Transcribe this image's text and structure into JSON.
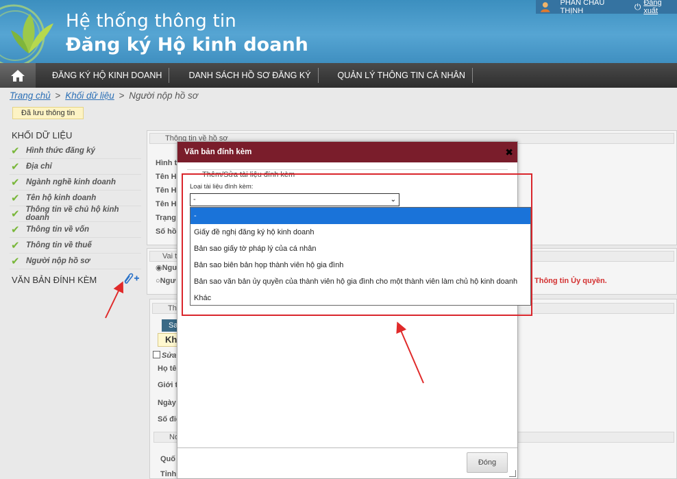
{
  "header": {
    "title_line1": "Hệ thống thông tin",
    "title_line2": "Đăng ký Hộ kinh doanh",
    "user_name": "PHAN CHÂU THỊNH",
    "logout_label": "Đăng xuất"
  },
  "nav": {
    "items": [
      {
        "label": "ĐĂNG KÝ HỘ KINH DOANH"
      },
      {
        "label": "DANH SÁCH HỒ SƠ ĐĂNG KÝ"
      },
      {
        "label": "QUẢN LÝ THÔNG TIN CÁ NHÂN"
      }
    ]
  },
  "breadcrumb": {
    "home": "Trang chủ",
    "section": "Khối dữ liệu",
    "current": "Người nộp hồ sơ",
    "sep": ">"
  },
  "saved_badge": "Đã lưu thông tin",
  "sidebar": {
    "title": "KHỐI DỮ LIỆU",
    "items": [
      {
        "label": "Hình thức đăng ký"
      },
      {
        "label": "Địa chỉ"
      },
      {
        "label": "Ngành nghề kinh doanh"
      },
      {
        "label": "Tên hộ kinh doanh"
      },
      {
        "label": "Thông tin về chủ hộ kinh doanh"
      },
      {
        "label": "Thông tin về vốn"
      },
      {
        "label": "Thông tin về thuế"
      },
      {
        "label": "Người nộp hồ sơ"
      }
    ],
    "attach_title": "VĂN BẢN ĐÍNH KÈM"
  },
  "background": {
    "legend1": "Thông tin về hồ sơ",
    "labels": [
      "Hình t",
      "Tên H",
      "Tên H",
      "Tên H",
      "Trạng",
      "Số hồ"
    ],
    "legend2": "Vai t",
    "radio1": "Ngư",
    "radio2": "Ngư",
    "legend3": "Thô",
    "btn_small": "Sa",
    "kh": "Kh",
    "sua": "Sửa",
    "labels2": [
      "Họ tê",
      "Giới t",
      "Ngày",
      "Số điệ"
    ],
    "legend4": "No",
    "labels3": [
      "Quố",
      "Tỉnh"
    ],
    "red_note": "Thông tin Ủy quyền."
  },
  "modal": {
    "title": "Văn bản đính kèm",
    "fieldset_label": "Thêm/Sửa tài liệu đính kèm",
    "field_label": "Loại tài liệu đính kèm:",
    "select_value": "-",
    "close_button": "Đóng",
    "options": [
      {
        "label": "-",
        "selected": true
      },
      {
        "label": "Giấy đề nghị đăng ký hộ kinh doanh",
        "selected": false
      },
      {
        "label": "Bản sao giấy tờ pháp lý của cá nhân",
        "selected": false
      },
      {
        "label": "Bản sao biên bản họp thành viên hộ gia đình",
        "selected": false
      },
      {
        "label": "Bản sao văn bản ủy quyền của thành viên hộ gia đình cho một thành viên làm chủ hộ kinh doanh",
        "selected": false
      },
      {
        "label": "Khác",
        "selected": false
      }
    ]
  },
  "colors": {
    "header_blue": "#4a9ccb",
    "nav_dark": "#3a3a3a",
    "modal_header": "#7a1d2b",
    "selected_option": "#1a73d9",
    "annotation_red": "#d9252b",
    "check_green": "#79b73a"
  }
}
